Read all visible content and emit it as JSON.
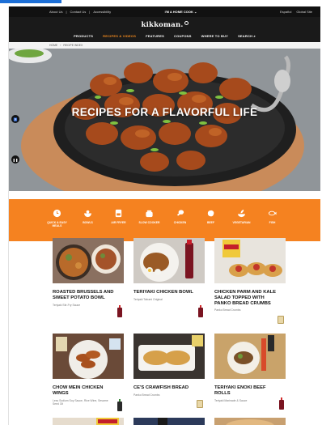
{
  "utility_bar": {
    "left_links": [
      "About Us",
      "Contact Us",
      "Accessibility"
    ],
    "center_text": "I'M A HOME COOK",
    "right_links": [
      "Español",
      "Global Site"
    ]
  },
  "brand": {
    "logo_text": "kikkoman."
  },
  "nav": {
    "items": [
      {
        "label": "PRODUCTS"
      },
      {
        "label": "RECIPES & VIDEOS"
      },
      {
        "label": "FEATURES"
      },
      {
        "label": "COUPONS"
      },
      {
        "label": "WHERE TO BUY"
      },
      {
        "label": "SEARCH"
      }
    ],
    "active_index": 1
  },
  "breadcrumb": [
    "HOME",
    "RECIPE INDEX"
  ],
  "hero": {
    "title": "RECIPES FOR A FLAVORFUL LIFE"
  },
  "categories": [
    {
      "label": "QUICK & EASY MEALS",
      "icon": "clock-icon"
    },
    {
      "label": "BOWLS",
      "icon": "bowl-icon"
    },
    {
      "label": "AIR FRYER",
      "icon": "air-fryer-icon"
    },
    {
      "label": "SLOW COOKER",
      "icon": "slow-cooker-icon"
    },
    {
      "label": "CHICKEN",
      "icon": "drumstick-icon"
    },
    {
      "label": "BEEF",
      "icon": "steak-icon"
    },
    {
      "label": "VEGETARIAN",
      "icon": "leaf-bowl-icon"
    },
    {
      "label": "FISH",
      "icon": "fish-icon"
    }
  ],
  "recipes": [
    {
      "title": "ROASTED BRUSSELS AND SWEET POTATO BOWL",
      "meta": "Teriyaki Stir-Fry Sauce"
    },
    {
      "title": "TERIYAKI CHICKEN BOWL",
      "meta": "Teriyaki Takumi Original"
    },
    {
      "title": "CHICKEN PARM AND KALE SALAD TOPPED WITH PANKO BREAD CRUMBS",
      "meta": "Panko Bread Crumbs"
    },
    {
      "title": "CHOW MEIN CHICKEN WINGS",
      "meta": "Less Sodium Soy Sauce, Rice Wine, Sesame Seed Oil"
    },
    {
      "title": "CE'S CRAWFISH BREAD",
      "meta": "Panko Bread Crumbs"
    },
    {
      "title": "TERIYAKI ENOKI BEEF ROLLS",
      "meta": "Teriyaki Marinade & Sauce"
    }
  ],
  "colors": {
    "brand_orange": "#f58220",
    "nav_black": "#1a1a1a",
    "active_nav": "#f28a1f"
  }
}
